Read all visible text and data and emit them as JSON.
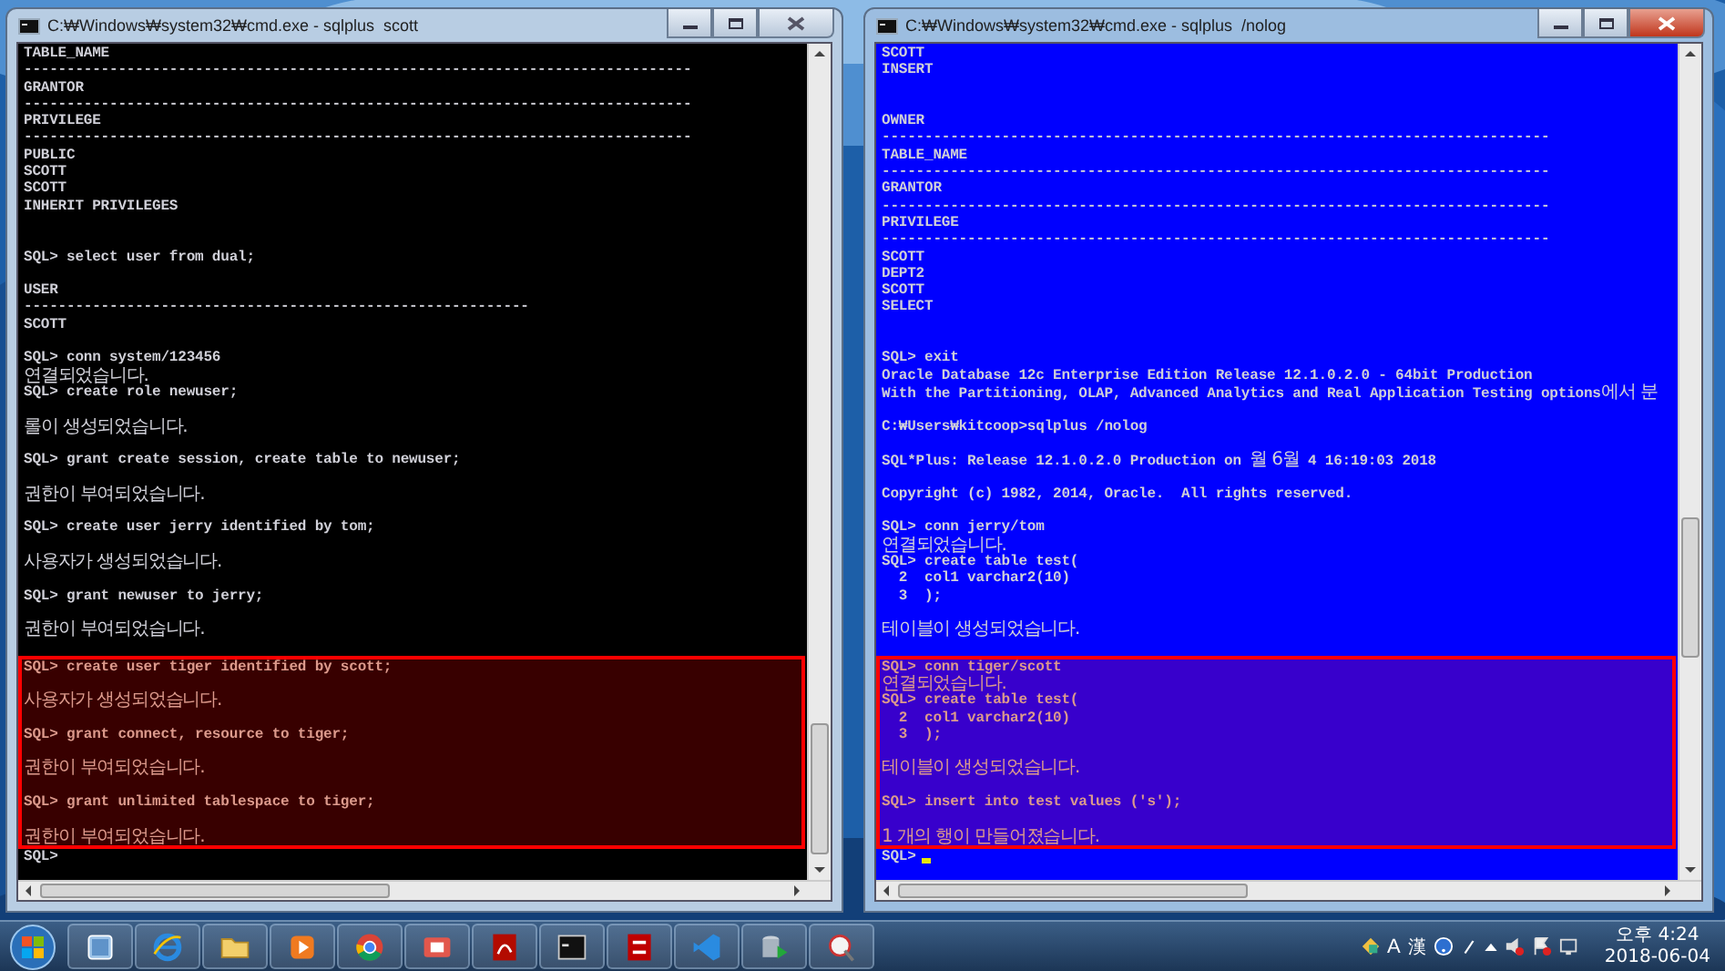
{
  "windows": [
    {
      "title": "C:₩Windows₩system32₩cmd.exe - sqlplus  scott",
      "active": false,
      "color": "#000000",
      "output": [
        {
          "kind": "text",
          "text": "TABLE_NAME"
        },
        {
          "kind": "text",
          "text": "------------------------------------------------------------------------------"
        },
        {
          "kind": "text",
          "text": "GRANTOR"
        },
        {
          "kind": "text",
          "text": "------------------------------------------------------------------------------"
        },
        {
          "kind": "text",
          "text": "PRIVILEGE"
        },
        {
          "kind": "text",
          "text": "------------------------------------------------------------------------------"
        },
        {
          "kind": "text",
          "text": "PUBLIC"
        },
        {
          "kind": "text",
          "text": "SCOTT"
        },
        {
          "kind": "text",
          "text": "SCOTT"
        },
        {
          "kind": "text",
          "text": "INHERIT PRIVILEGES"
        },
        {
          "kind": "blank"
        },
        {
          "kind": "blank"
        },
        {
          "kind": "text",
          "text": "SQL> select user from dual;"
        },
        {
          "kind": "blank"
        },
        {
          "kind": "text",
          "text": "USER"
        },
        {
          "kind": "text",
          "text": "-----------------------------------------------------------"
        },
        {
          "kind": "text",
          "text": "SCOTT"
        },
        {
          "kind": "blank"
        },
        {
          "kind": "text",
          "text": "SQL> conn system/123456"
        },
        {
          "kind": "message",
          "text": "연결되었습니다."
        },
        {
          "kind": "text",
          "text": "SQL> create role newuser;"
        },
        {
          "kind": "blank"
        },
        {
          "kind": "message",
          "text": "롤이 생성되었습니다."
        },
        {
          "kind": "blank"
        },
        {
          "kind": "text",
          "text": "SQL> grant create session, create table to newuser;"
        },
        {
          "kind": "blank"
        },
        {
          "kind": "message",
          "text": "권한이 부여되었습니다."
        },
        {
          "kind": "blank"
        },
        {
          "kind": "text",
          "text": "SQL> create user jerry identified by tom;"
        },
        {
          "kind": "blank"
        },
        {
          "kind": "message",
          "text": "사용자가 생성되었습니다."
        },
        {
          "kind": "blank"
        },
        {
          "kind": "text",
          "text": "SQL> grant newuser to jerry;"
        },
        {
          "kind": "blank"
        },
        {
          "kind": "message",
          "text": "권한이 부여되었습니다."
        },
        {
          "kind": "blank"
        }
      ],
      "highlighted_output": [
        {
          "kind": "text",
          "text": "SQL> create user tiger identified by scott;"
        },
        {
          "kind": "blank"
        },
        {
          "kind": "message",
          "text": "사용자가 생성되었습니다."
        },
        {
          "kind": "blank"
        },
        {
          "kind": "text",
          "text": "SQL> grant connect, resource to tiger;"
        },
        {
          "kind": "blank"
        },
        {
          "kind": "message",
          "text": "권한이 부여되었습니다."
        },
        {
          "kind": "blank"
        },
        {
          "kind": "text",
          "text": "SQL> grant unlimited tablespace to tiger;"
        },
        {
          "kind": "blank"
        },
        {
          "kind": "message",
          "text": "권한이 부여되었습니다."
        }
      ],
      "prompt": {
        "text": "SQL>"
      }
    },
    {
      "title": "C:₩Windows₩system32₩cmd.exe - sqlplus  /nolog",
      "active": true,
      "color": "#0000ff",
      "output": [
        {
          "kind": "text",
          "text": "SCOTT"
        },
        {
          "kind": "text",
          "text": "INSERT"
        },
        {
          "kind": "blank"
        },
        {
          "kind": "blank"
        },
        {
          "kind": "text",
          "text": "OWNER"
        },
        {
          "kind": "text",
          "text": "------------------------------------------------------------------------------"
        },
        {
          "kind": "text",
          "text": "TABLE_NAME"
        },
        {
          "kind": "text",
          "text": "------------------------------------------------------------------------------"
        },
        {
          "kind": "text",
          "text": "GRANTOR"
        },
        {
          "kind": "text",
          "text": "------------------------------------------------------------------------------"
        },
        {
          "kind": "text",
          "text": "PRIVILEGE"
        },
        {
          "kind": "text",
          "text": "------------------------------------------------------------------------------"
        },
        {
          "kind": "text",
          "text": "SCOTT"
        },
        {
          "kind": "text",
          "text": "DEPT2"
        },
        {
          "kind": "text",
          "text": "SCOTT"
        },
        {
          "kind": "text",
          "text": "SELECT"
        },
        {
          "kind": "blank"
        },
        {
          "kind": "blank"
        },
        {
          "kind": "text",
          "text": "SQL> exit"
        },
        {
          "kind": "text",
          "text": "Oracle Database 12c Enterprise Edition Release 12.1.0.2.0 - 64bit Production"
        },
        {
          "kind": "mixed",
          "segments": [
            {
              "kind": "latin",
              "text": "With the Partitioning, OLAP, Advanced Analytics and Real Application Testing options"
            },
            {
              "kind": "hangul",
              "text": "에서 분"
            }
          ]
        },
        {
          "kind": "blank"
        },
        {
          "kind": "text",
          "text": "C:₩Users₩kitcoop>sqlplus /nolog"
        },
        {
          "kind": "blank"
        },
        {
          "kind": "mixed",
          "segments": [
            {
              "kind": "latin",
              "text": "SQL*Plus: Release 12.1.0.2.0 Production on "
            },
            {
              "kind": "hangul",
              "text": "월 6월"
            },
            {
              "kind": "latin",
              "text": " 4 16:19:03 2018"
            }
          ]
        },
        {
          "kind": "blank"
        },
        {
          "kind": "text",
          "text": "Copyright (c) 1982, 2014, Oracle.  All rights reserved."
        },
        {
          "kind": "blank"
        },
        {
          "kind": "text",
          "text": "SQL> conn jerry/tom"
        },
        {
          "kind": "message",
          "text": "연결되었습니다."
        },
        {
          "kind": "text",
          "text": "SQL> create table test("
        },
        {
          "kind": "text",
          "text": "  2  col1 varchar2(10)"
        },
        {
          "kind": "text",
          "text": "  3  );"
        },
        {
          "kind": "blank"
        },
        {
          "kind": "message",
          "text": "테이블이 생성되었습니다."
        },
        {
          "kind": "blank"
        }
      ],
      "highlighted_output": [
        {
          "kind": "text",
          "text": "SQL> conn tiger/scott"
        },
        {
          "kind": "message",
          "text": "연결되었습니다."
        },
        {
          "kind": "text",
          "text": "SQL> create table test("
        },
        {
          "kind": "text",
          "text": "  2  col1 varchar2(10)"
        },
        {
          "kind": "text",
          "text": "  3  );"
        },
        {
          "kind": "blank"
        },
        {
          "kind": "message",
          "text": "테이블이 생성되었습니다."
        },
        {
          "kind": "blank"
        },
        {
          "kind": "text",
          "text": "SQL> insert into test values ('s');"
        },
        {
          "kind": "blank"
        },
        {
          "kind": "message",
          "text": "1 개의 행이 만들어졌습니다."
        }
      ],
      "prompt": {
        "text": "SQL>",
        "cursor": true
      }
    }
  ],
  "taskbar": {
    "ime": [
      "A",
      "漢"
    ],
    "clock": {
      "time": "오후 4:24",
      "date": "2018-06-04"
    }
  }
}
